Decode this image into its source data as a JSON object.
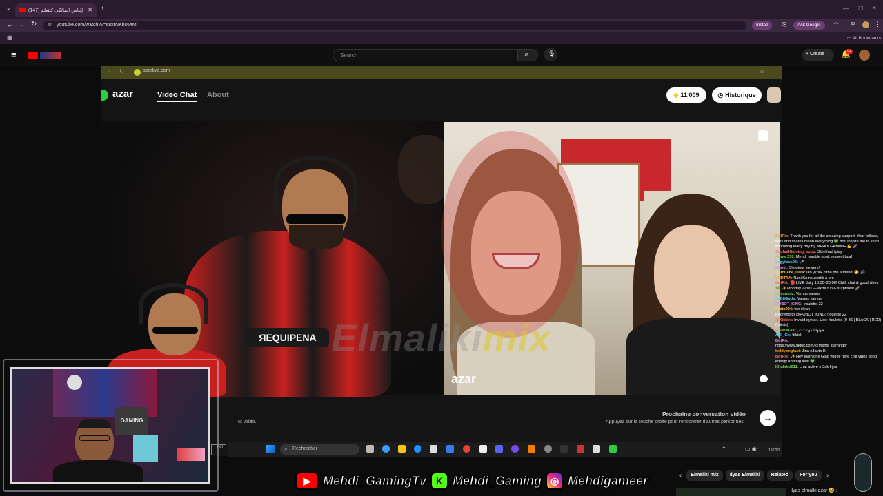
{
  "browser": {
    "tab_title": "(147) إلياس المالكي كيتعلم",
    "url": "youtube.com/watch?v=s8xrNKhc64M",
    "install_label": "Install",
    "ask_google_label": "Ask Google",
    "all_bookmarks_label": "All Bookmarks"
  },
  "youtube": {
    "search_placeholder": "Search",
    "create_label": "Create",
    "notification_badge": "9+"
  },
  "azar": {
    "inner_url": "azarlive.com",
    "logo": "azar",
    "nav_video_chat": "Video Chat",
    "nav_about": "About",
    "coins": "11,009",
    "historique": "Historique",
    "watermark_left": "Elmaliki",
    "watermark_right": "mix",
    "video_logo": "azar",
    "next_title": "Prochaine conversation vidéo",
    "next_subtitle": "Appuyez sur la touche droite pour rencontrer d'autres personnes",
    "left_text": "ut vidéo."
  },
  "taskbar": {
    "search_placeholder": "Rechercher",
    "date": "13/02/2"
  },
  "chat": [
    {
      "user": "BotRix:",
      "text": "Thank you for all the amazing support! Your follows, likes and shares mean everything 💚 You inspire me to keep improving every day By MEHDI GAMING 💪 🚀"
    },
    {
      "user": "SouhailGaming_supp:",
      "text": "3jbni had lplay"
    },
    {
      "user": "Anwar230:",
      "text": "Mehdi humble goat, respect bzaf"
    },
    {
      "user": "angytous95:",
      "text": "🎤"
    },
    {
      "user": "Ghost:",
      "text": "Shoutout viewers!"
    },
    {
      "user": "warouane_0009:",
      "text": "lah ykhlik dima pro a mehdi 😊 🔊"
    },
    {
      "user": "VNDTAA:",
      "text": "Rani Ka nsuportik a bro"
    },
    {
      "user": "BotRix:",
      "text": "🔴 LIVE daily 16:00–20:00! Chill, chat & good vibes 💚 ✨ Monday 22:00 — extra fun & surprises! 🚀"
    },
    {
      "user": "Khesusdz:",
      "text": "Vamos vamos"
    },
    {
      "user": "YoDiiGaUs:",
      "text": "Vamos vamos"
    },
    {
      "user": "ROBOT_KING:",
      "text": "!roulette 22"
    },
    {
      "user": "Proto994:",
      "text": "too clean"
    },
    {
      "user": "",
      "text": "Replying to @ROBOT_KING: !roulette 22"
    },
    {
      "user": "@Kicklet:",
      "text": "Invalid syntax. Use: !roulette (0-36 | BLACK | RED) (points)"
    },
    {
      "user": "GAMINGDZ_27:",
      "text": "خوتها الدولة"
    },
    {
      "user": "Alili_Ch:",
      "text": "!tiktok"
    },
    {
      "user": "BotRix:",
      "text": ""
    },
    {
      "user": "",
      "text": "https://www.tiktok.com/@mehdi_gamingtv"
    },
    {
      "user": "teddyongfast:",
      "text": "Jina n3ayto lik"
    },
    {
      "user": "BotRix:",
      "text": "✨ Hey everyone Glad you're here chill vibes good energy and big love 💚"
    },
    {
      "user": "Khalidrd011:",
      "text": "chat active m3ak frjna"
    }
  ],
  "banner": {
    "youtube_handle": "Mehdi_GamingTv",
    "kick_handle": "Mehdi_Gaming",
    "instagram_handle": "Mehdigameer"
  },
  "chips": [
    "Elmaliki mix",
    "Ilyas Elmaliki",
    "Related",
    "For you"
  ],
  "below_item": "ilyas elmalki azar 😃 :"
}
